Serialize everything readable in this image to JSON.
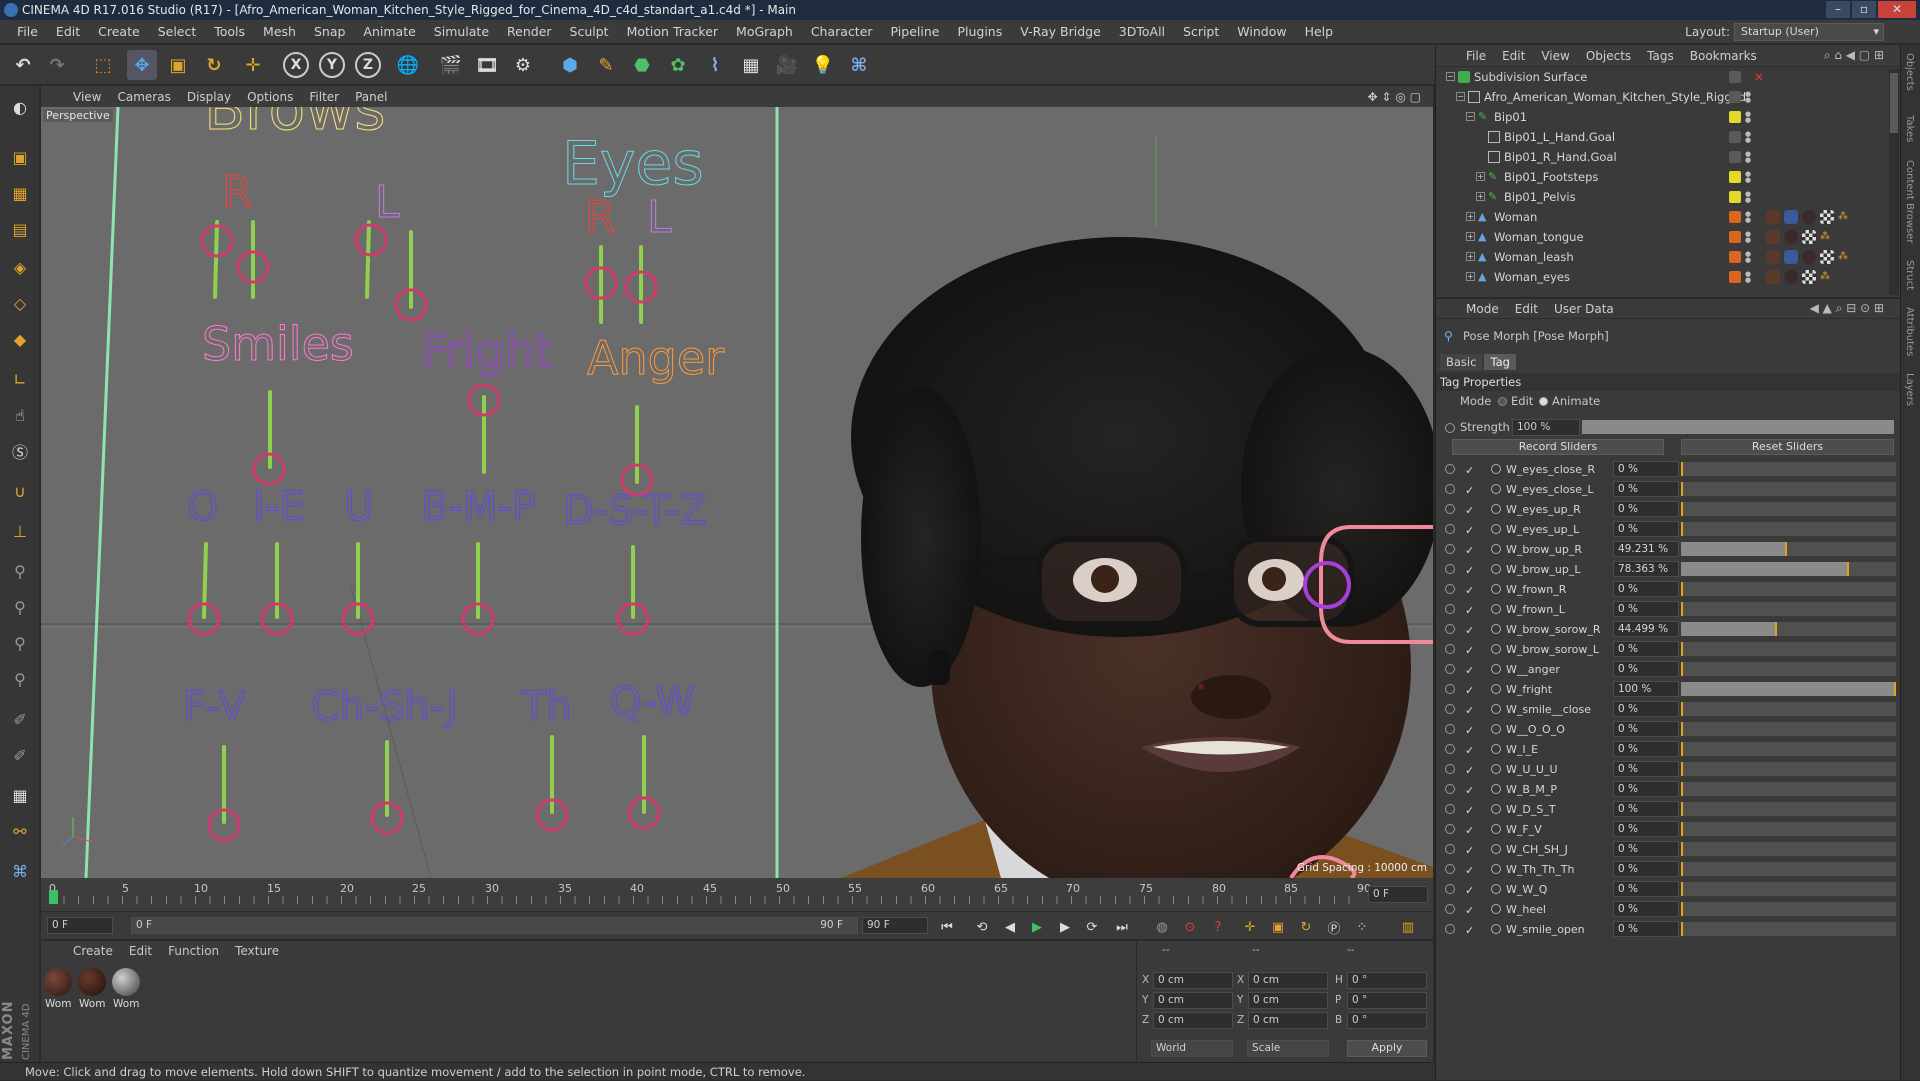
{
  "window": {
    "title": "CINEMA 4D R17.016 Studio (R17) - [Afro_American_Woman_Kitchen_Style_Rigged_for_Cinema_4D_c4d_standart_a1.c4d *] - Main"
  },
  "menubar": {
    "items": [
      "File",
      "Edit",
      "Create",
      "Select",
      "Tools",
      "Mesh",
      "Snap",
      "Animate",
      "Simulate",
      "Render",
      "Sculpt",
      "Motion Tracker",
      "MoGraph",
      "Character",
      "Pipeline",
      "Plugins",
      "V-Ray Bridge",
      "3DToAll",
      "Script",
      "Window",
      "Help"
    ],
    "layout_label": "Layout:",
    "layout_value": "Startup (User)"
  },
  "viewport": {
    "menu": [
      "View",
      "Cameras",
      "Display",
      "Options",
      "Filter",
      "Panel"
    ],
    "label": "Perspective",
    "grid_spacing": "Grid Spacing : 10000 cm",
    "headings": {
      "brows": "Brows",
      "eyes": "Eyes",
      "smiles": "Smiles",
      "fright": "Fright",
      "anger": "Anger",
      "r1": "R",
      "l1": "L",
      "r2": "R",
      "l2": "L",
      "o": "O",
      "ie": "I-E",
      "u": "U",
      "bmp": "B-M-P",
      "dstz": "D-S-T-Z",
      "fv": "F-V",
      "chshj": "Ch-Sh-J",
      "th": "Th",
      "qw": "Q-W"
    },
    "colors": {
      "bg": "#6b6b6b",
      "slider": "#8fd14f",
      "handle": "#d23a6c"
    }
  },
  "timeline": {
    "ticks": [
      "0",
      "5",
      "10",
      "15",
      "20",
      "25",
      "30",
      "35",
      "40",
      "45",
      "50",
      "55",
      "60",
      "65",
      "70",
      "75",
      "80",
      "85",
      "90"
    ],
    "current_frame": "0 F",
    "start_field": "0 F",
    "range_start": "0 F",
    "range_end": "90 F",
    "end_field": "90 F"
  },
  "material_manager": {
    "menu": [
      "Create",
      "Edit",
      "Function",
      "Texture"
    ],
    "materials": [
      {
        "label": "Wom"
      },
      {
        "label": "Wom"
      },
      {
        "label": "Wom"
      }
    ]
  },
  "coordinates": {
    "headers": [
      "--",
      "--",
      "--"
    ],
    "rows": [
      {
        "a": "X",
        "av": "0 cm",
        "b": "X",
        "bv": "0 cm",
        "c": "H",
        "cv": "0 °"
      },
      {
        "a": "Y",
        "av": "0 cm",
        "b": "Y",
        "bv": "0 cm",
        "c": "P",
        "cv": "0 °"
      },
      {
        "a": "Z",
        "av": "0 cm",
        "b": "Z",
        "bv": "0 cm",
        "c": "B",
        "cv": "0 °"
      }
    ],
    "world": "World",
    "scale": "Scale",
    "apply": "Apply"
  },
  "status": "Move: Click and drag to move elements. Hold down SHIFT to quantize movement / add to the selection in point mode, CTRL to remove.",
  "maxon": {
    "brand": "MAXON",
    "product": "CINEMA 4D"
  },
  "object_manager": {
    "menu": [
      "File",
      "Edit",
      "View",
      "Objects",
      "Tags",
      "Bookmarks"
    ],
    "rows": [
      {
        "name": "Subdivision Surface",
        "depth": 0,
        "color": "#4fb84f"
      },
      {
        "name": "Afro_American_Woman_Kitchen_Style_Rigged",
        "depth": 1,
        "color": "#bbbbbb"
      },
      {
        "name": "Bip01",
        "depth": 2,
        "color": "#4fb84f"
      },
      {
        "name": "Bip01_L_Hand.Goal",
        "depth": 3,
        "color": "#bbbbbb"
      },
      {
        "name": "Bip01_R_Hand.Goal",
        "depth": 3,
        "color": "#bbbbbb"
      },
      {
        "name": "Bip01_Footsteps",
        "depth": 3,
        "color": "#4fb84f"
      },
      {
        "name": "Bip01_Pelvis",
        "depth": 3,
        "color": "#4fb84f"
      },
      {
        "name": "Woman",
        "depth": 2,
        "color": "#6aa0e0"
      },
      {
        "name": "Woman_tongue",
        "depth": 2,
        "color": "#6aa0e0"
      },
      {
        "name": "Woman_leash",
        "depth": 2,
        "color": "#6aa0e0"
      },
      {
        "name": "Woman_eyes",
        "depth": 2,
        "color": "#6aa0e0"
      }
    ]
  },
  "attributes": {
    "menu": [
      "Mode",
      "Edit",
      "User Data"
    ],
    "title": "Pose Morph [Pose Morph]",
    "tabs": [
      "Basic",
      "Tag"
    ],
    "section": "Tag Properties",
    "mode_label": "Mode",
    "mode_edit": "Edit",
    "mode_animate": "Animate",
    "strength_label": "Strength",
    "strength_value": "100 %",
    "record": "Record Sliders",
    "reset": "Reset Sliders",
    "morphs": [
      {
        "name": "W_eyes_close_R",
        "value": "0 %",
        "pct": 0
      },
      {
        "name": "W_eyes_close_L",
        "value": "0 %",
        "pct": 0
      },
      {
        "name": "W_eyes_up_R",
        "value": "0 %",
        "pct": 0
      },
      {
        "name": "W_eyes_up_L",
        "value": "0 %",
        "pct": 0
      },
      {
        "name": "W_brow_up_R",
        "value": "49.231 %",
        "pct": 49.231
      },
      {
        "name": "W_brow_up_L",
        "value": "78.363 %",
        "pct": 78.363
      },
      {
        "name": "W_frown_R",
        "value": "0 %",
        "pct": 0
      },
      {
        "name": "W_frown_L",
        "value": "0 %",
        "pct": 0
      },
      {
        "name": "W_brow_sorow_R",
        "value": "44.499 %",
        "pct": 44.499
      },
      {
        "name": "W_brow_sorow_L",
        "value": "0 %",
        "pct": 0
      },
      {
        "name": "W__anger",
        "value": "0 %",
        "pct": 0
      },
      {
        "name": "W_fright",
        "value": "100 %",
        "pct": 100
      },
      {
        "name": "W_smile__close",
        "value": "0 %",
        "pct": 0
      },
      {
        "name": "W__O_O_O",
        "value": "0 %",
        "pct": 0
      },
      {
        "name": "W_I_E",
        "value": "0 %",
        "pct": 0
      },
      {
        "name": "W_U_U_U",
        "value": "0 %",
        "pct": 0
      },
      {
        "name": "W_B_M_P",
        "value": "0 %",
        "pct": 0
      },
      {
        "name": "W_D_S_T",
        "value": "0 %",
        "pct": 0
      },
      {
        "name": "W_F_V",
        "value": "0 %",
        "pct": 0
      },
      {
        "name": "W_CH_SH_J",
        "value": "0 %",
        "pct": 0
      },
      {
        "name": "W_Th_Th_Th",
        "value": "0 %",
        "pct": 0
      },
      {
        "name": "W_W_Q",
        "value": "0 %",
        "pct": 0
      },
      {
        "name": "W_heel",
        "value": "0 %",
        "pct": 0
      },
      {
        "name": "W_smile_open",
        "value": "0 %",
        "pct": 0
      }
    ]
  },
  "right_strip": [
    "Objects",
    "Takes",
    "Content Browser",
    "Struct",
    "Attributes",
    "Layers"
  ]
}
